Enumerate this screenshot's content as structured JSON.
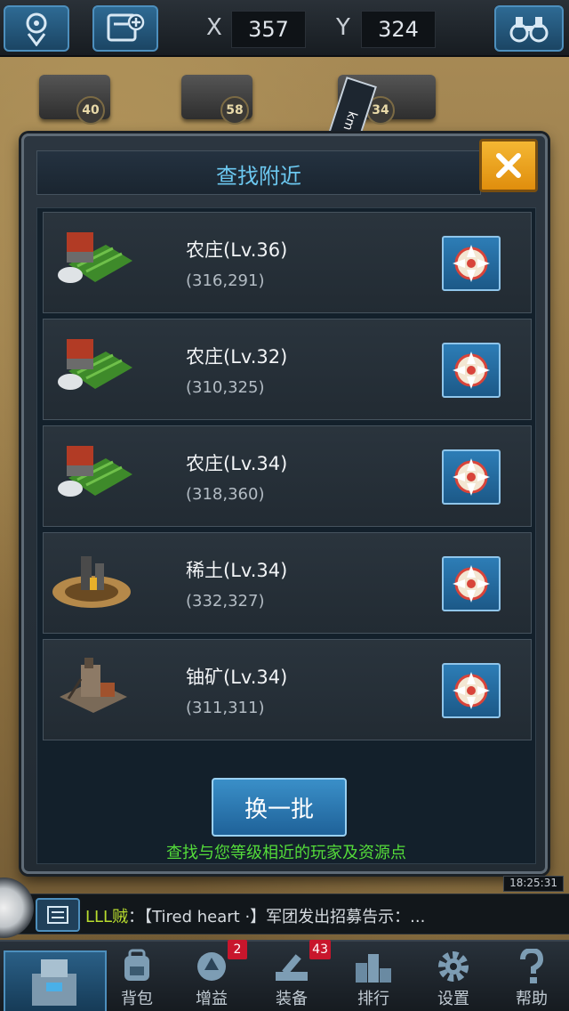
{
  "topbar": {
    "x_label": "X",
    "x_value": "357",
    "y_label": "Y",
    "y_value": "324",
    "location_icon": "map-pin-icon",
    "bookmark_icon": "add-bookmark-icon",
    "search_icon": "binoculars-icon"
  },
  "map": {
    "levels": [
      "40",
      "58",
      "34"
    ],
    "marker_text": "km"
  },
  "dialog": {
    "title": "查找附近",
    "close_icon": "close-icon",
    "items": [
      {
        "name": "农庄(Lv.36)",
        "coord": "(316,291)",
        "icon": "farm-icon"
      },
      {
        "name": "农庄(Lv.32)",
        "coord": "(310,325)",
        "icon": "farm-icon"
      },
      {
        "name": "农庄(Lv.34)",
        "coord": "(318,360)",
        "icon": "farm-icon"
      },
      {
        "name": "稀土(Lv.34)",
        "coord": "(332,327)",
        "icon": "rare-earth-mine-icon"
      },
      {
        "name": "铀矿(Lv.34)",
        "coord": "(311,311)",
        "icon": "uranium-mine-icon"
      }
    ],
    "refresh_label": "换一批",
    "hint": "查找与您等级相近的玩家及资源点"
  },
  "chat": {
    "sender": "LLL贼",
    "message": "：【Tired heart ·】军团发出招募告示：...",
    "clock": "18:25:31"
  },
  "nav": {
    "items": [
      {
        "label": "背包",
        "icon": "backpack-icon",
        "badge": ""
      },
      {
        "label": "增益",
        "icon": "boost-icon",
        "badge": "2"
      },
      {
        "label": "装备",
        "icon": "equipment-icon",
        "badge": "43"
      },
      {
        "label": "排行",
        "icon": "ranking-icon",
        "badge": ""
      },
      {
        "label": "设置",
        "icon": "gear-icon",
        "badge": ""
      },
      {
        "label": "帮助",
        "icon": "help-icon",
        "badge": ""
      }
    ]
  },
  "colors": {
    "title": "#6cc8f0",
    "hint": "#54dc3a",
    "close_button": "#f4b733",
    "locate_button": "#2d7db6",
    "badge": "#c8162c"
  }
}
